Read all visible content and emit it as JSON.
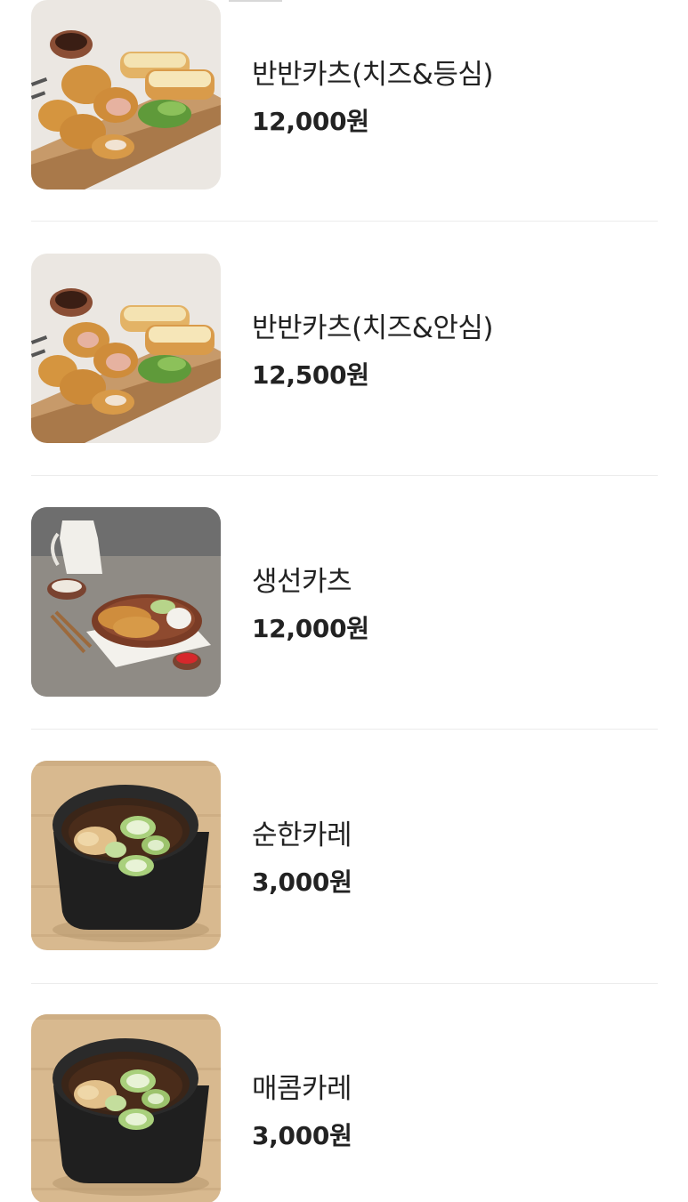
{
  "menu": {
    "items": [
      {
        "name": "반반카츠(치즈&등심)",
        "price": "12,000원",
        "image": "cheese-loin-katsu-photo"
      },
      {
        "name": "반반카츠(치즈&안심)",
        "price": "12,500원",
        "image": "cheese-tenderloin-katsu-photo"
      },
      {
        "name": "생선카츠",
        "price": "12,000원",
        "image": "fish-katsu-photo"
      },
      {
        "name": "순한카레",
        "price": "3,000원",
        "image": "mild-curry-photo"
      },
      {
        "name": "매콤카레",
        "price": "3,000원",
        "image": "spicy-curry-photo"
      }
    ]
  },
  "colors": {
    "text": "#222222",
    "divider": "#ececec",
    "background": "#ffffff"
  }
}
